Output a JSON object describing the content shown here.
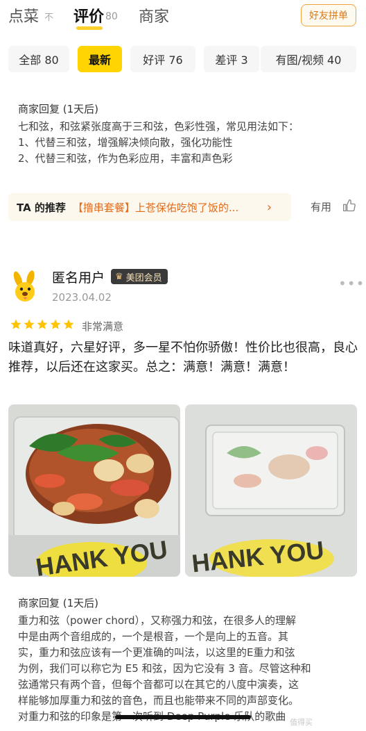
{
  "top_tabs": {
    "dishes": "点菜",
    "sort_icon": "不",
    "reviews": "评价",
    "reviews_count": "80",
    "merchant": "商家",
    "friend_button": "好友拼单"
  },
  "filters": [
    {
      "label": "全部 80"
    },
    {
      "label": "最新"
    },
    {
      "label": "好评 76"
    },
    {
      "label": "差评 3"
    },
    {
      "label": "有图/视频 40"
    }
  ],
  "first_reply": {
    "title": "商家回复 (1天后)",
    "lines": [
      "七和弦，和弦紧张度高于三和弦，色彩性强，常见用法如下：",
      "1、代替三和弦，增强解决倾向散，强化功能性",
      "2、代替三和弦，作为色彩应用，丰富和声色彩"
    ]
  },
  "recommend": {
    "label": "TA 的推荐",
    "text": "【撸串套餐】上苍保佑吃饱了饭的...",
    "useful": "有用"
  },
  "review": {
    "username": "匿名用户",
    "vip_label": "美团会员",
    "date": "2023.04.02",
    "rating_text": "非常满意",
    "stars": 5,
    "text": "味道真好，六星好评，多一星不怕你骄傲！性价比也很高，良心推荐，以后还在这家买。总之：满意！满意！满意！",
    "photo_text_1": "HANK YOU",
    "photo_text_2": "HANK YOU"
  },
  "second_reply": {
    "title": "商家回复 (1天后)",
    "lines": [
      "重力和弦（power chord），又称强力和弦，在很多人的理解",
      "中是由两个音组成的，一个是根音，一个是向上的五音。其",
      "实，重力和弦应该有一个更准确的叫法，以这里的E重力和弦",
      "为例，我们可以称它为 E5 和弦，因为它没有 3 音。尽管这种和",
      "弦通常只有两个音，但每个音都可以在其它的八度中演奏，这",
      "样能够加厚重力和弦的音色，而且也能带来不同的声部变化。",
      "对重力和弦的印象是第一次听到 Deep Purple 乐队的歌曲"
    ]
  },
  "watermark": "值得买",
  "colors": {
    "accent": "#ffd400",
    "orange": "#e36b1a",
    "star": "#ffc300"
  }
}
